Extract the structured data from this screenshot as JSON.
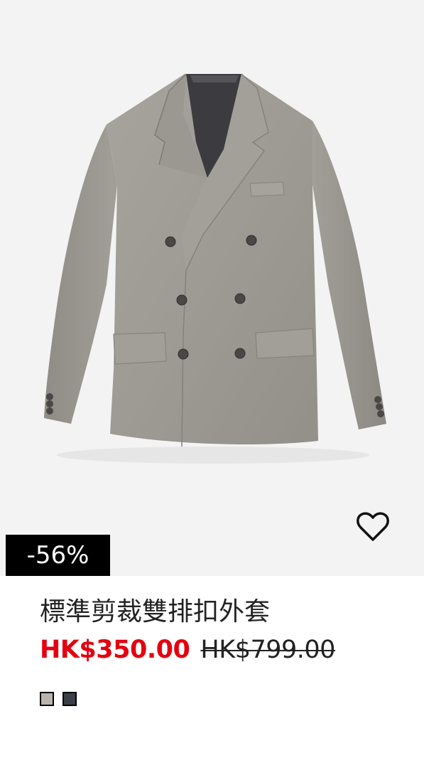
{
  "product": {
    "image_alt": "灰色雙排扣西裝外套",
    "discount_badge": "-56%",
    "title": "標準剪裁雙排扣外套",
    "sale_price": "HK$350.00",
    "original_price": "HK$799.00",
    "wishlist_icon": "heart-outline-icon",
    "colors": {
      "accent_sale": "#e50010",
      "badge_bg": "#000000",
      "image_bg": "#f3f3f3"
    },
    "swatches": [
      {
        "color": "#b9b4ae"
      },
      {
        "color": "#3b3f48"
      }
    ]
  }
}
